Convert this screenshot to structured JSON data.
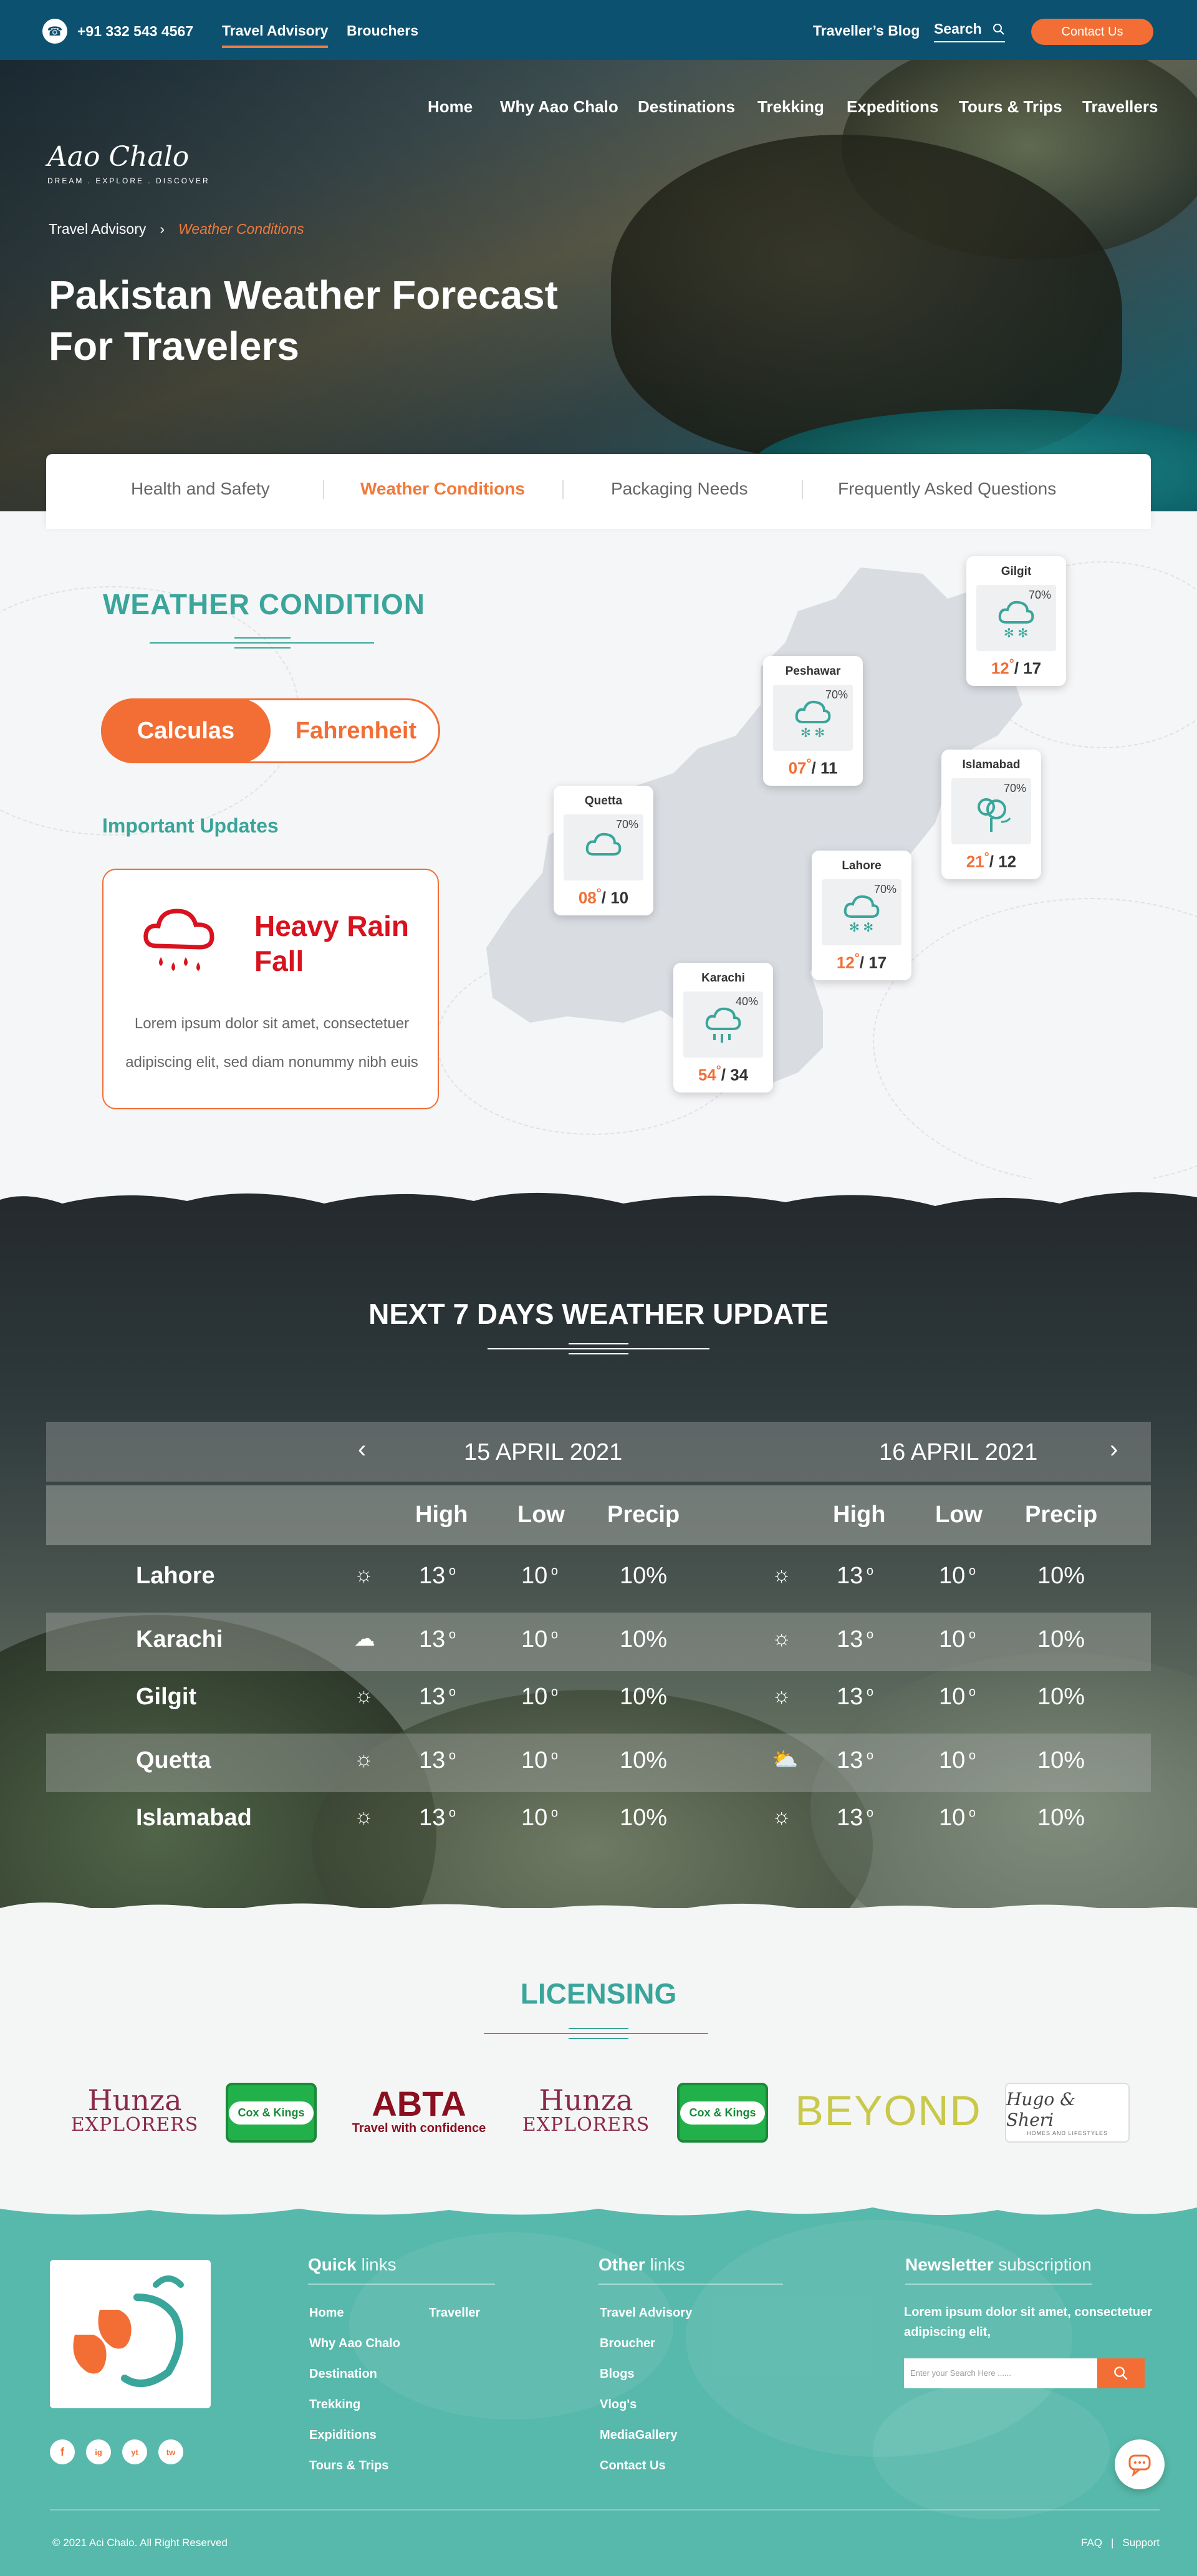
{
  "topbar": {
    "phone": "+91 332 543 4567",
    "links": [
      "Travel Advisory",
      "Brouchers"
    ],
    "blog": "Traveller’s Blog",
    "search_label": "Search",
    "contact": "Contact Us"
  },
  "logo": {
    "name": "Aao Chalo",
    "tagline": "DREAM . EXPLORE . DISCOVER"
  },
  "nav": [
    "Home",
    "Why Aao Chalo",
    "Destinations",
    "Trekking",
    "Expeditions",
    "Tours & Trips",
    "Travellers"
  ],
  "breadcrumb": {
    "parent": "Travel Advisory",
    "separator": "›",
    "current": "Weather Conditions"
  },
  "hero": {
    "title_line1": "Pakistan Weather Forecast",
    "title_line2": "For Travelers"
  },
  "tabs": [
    {
      "label": "Health and Safety",
      "active": false
    },
    {
      "label": "Weather Conditions",
      "active": true
    },
    {
      "label": "Packaging Needs",
      "active": false
    },
    {
      "label": "Frequently Asked Questions",
      "active": false
    }
  ],
  "weather": {
    "title": "WEATHER CONDITION",
    "toggle": {
      "on": "Calculas",
      "off": "Fahrenheit"
    },
    "updates_title": "Important Updates",
    "alert": {
      "title": "Heavy Rain Fall",
      "text": "Lorem ipsum dolor sit amet, consectetuer adipiscing elit, sed diam nonummy nibh euis"
    },
    "cities": [
      {
        "name": "Gilgit",
        "precip": "70%",
        "hi": "12",
        "lo": "17",
        "icon": "snow-cloud-icon"
      },
      {
        "name": "Peshawar",
        "precip": "70%",
        "hi": "07",
        "lo": "11",
        "icon": "snow-cloud-icon"
      },
      {
        "name": "Islamabad",
        "precip": "70%",
        "hi": "21",
        "lo": "12",
        "icon": "tree-wind-icon"
      },
      {
        "name": "Quetta",
        "precip": "70%",
        "hi": "08",
        "lo": "10",
        "icon": "cloud-icon"
      },
      {
        "name": "Lahore",
        "precip": "70%",
        "hi": "12",
        "lo": "17",
        "icon": "snow-cloud-icon"
      },
      {
        "name": "Karachi",
        "precip": "40%",
        "hi": "54",
        "lo": "34",
        "icon": "rain-cloud-icon"
      }
    ],
    "accent": "#3aa59a",
    "orange": "#f26e34",
    "alert_red": "#d8121e"
  },
  "forecast": {
    "title": "NEXT 7 DAYS WEATHER UPDATE",
    "dates": [
      "15 APRIL 2021",
      "16 APRIL 2021"
    ],
    "columns": [
      "High",
      "Low",
      "Precip"
    ],
    "degree": "o",
    "rows": [
      {
        "city": "Lahore",
        "d1": {
          "icon": "sun-icon",
          "high": "13",
          "low": "10",
          "precip": "10%"
        },
        "d2": {
          "icon": "sun-icon",
          "high": "13",
          "low": "10",
          "precip": "10%"
        }
      },
      {
        "city": "Karachi",
        "d1": {
          "icon": "storm-cloud-icon",
          "high": "13",
          "low": "10",
          "precip": "10%"
        },
        "d2": {
          "icon": "sun-icon",
          "high": "13",
          "low": "10",
          "precip": "10%"
        }
      },
      {
        "city": "Gilgit",
        "d1": {
          "icon": "sun-icon",
          "high": "13",
          "low": "10",
          "precip": "10%"
        },
        "d2": {
          "icon": "sun-icon",
          "high": "13",
          "low": "10",
          "precip": "10%"
        }
      },
      {
        "city": "Quetta",
        "d1": {
          "icon": "sun-icon",
          "high": "13",
          "low": "10",
          "precip": "10%"
        },
        "d2": {
          "icon": "partly-cloudy-icon",
          "high": "13",
          "low": "10",
          "precip": "10%"
        }
      },
      {
        "city": "Islamabad",
        "d1": {
          "icon": "sun-icon",
          "high": "13",
          "low": "10",
          "precip": "10%"
        },
        "d2": {
          "icon": "sun-icon",
          "high": "13",
          "low": "10",
          "precip": "10%"
        }
      }
    ]
  },
  "licensing": {
    "title": "LICENSING",
    "logos": [
      {
        "name": "hunza-explorers",
        "line1": "Hunza",
        "line2": "EXPLORERS"
      },
      {
        "name": "cox-kings",
        "line1": "Cox & Kings"
      },
      {
        "name": "abta",
        "line1": "ABTA",
        "line2": "Travel with confidence"
      },
      {
        "name": "hunza-explorers-2",
        "line1": "Hunza",
        "line2": "EXPLORERS"
      },
      {
        "name": "cox-kings-2",
        "line1": "Cox & Kings"
      },
      {
        "name": "beyond",
        "line1": "BEYOND"
      },
      {
        "name": "hugo-sheri",
        "line1": "Hugo & Sheri",
        "line2": "HOMES AND LIFESTYLES"
      }
    ]
  },
  "footer": {
    "quick_title_bold": "Quick",
    "quick_title_rest": " links",
    "quick_links_col1": [
      "Home",
      "Why Aao Chalo",
      "Destination",
      "Trekking",
      "Expiditions",
      "Tours & Trips"
    ],
    "quick_links_col2": [
      "Traveller"
    ],
    "other_title_bold": "Other",
    "other_title_rest": " links",
    "other_links": [
      "Travel Advisory",
      "Broucher",
      "Blogs",
      "Vlog's",
      "MediaGallery",
      "Contact Us"
    ],
    "news_title_bold": "Newsletter",
    "news_title_rest": " subscription",
    "news_text": "Lorem ipsum dolor sit amet, consectetuer adipiscing elit,",
    "news_placeholder": "Enter your Search Here ......",
    "copyright": "© 2021 Aci Chalo. All Right Reserved",
    "bottom_links": [
      "FAQ",
      "Support"
    ],
    "social": [
      "f",
      "ig",
      "yt",
      "tw"
    ]
  }
}
